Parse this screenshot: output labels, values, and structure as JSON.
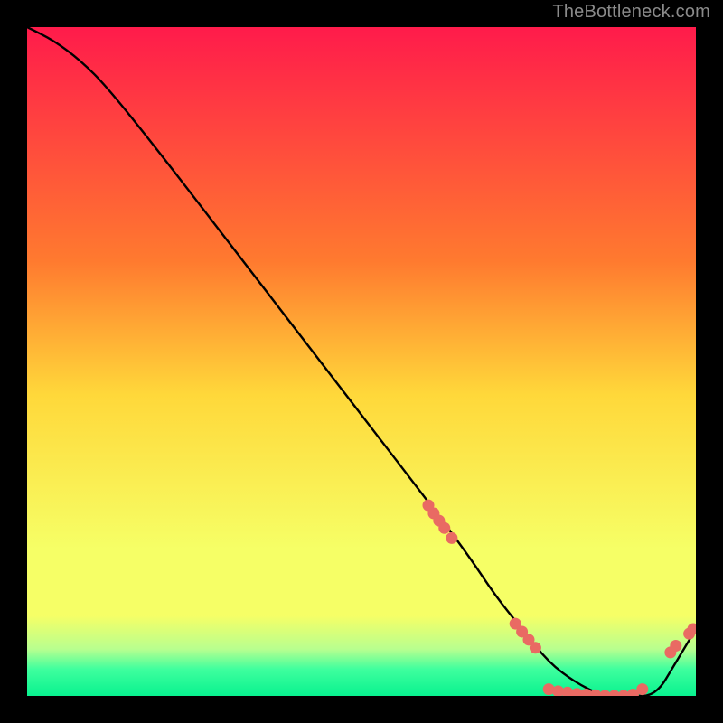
{
  "attribution": "TheBottleneck.com",
  "colors": {
    "gradient_top": "#ff1b4b",
    "gradient_upper_mid": "#ff7a2f",
    "gradient_mid": "#ffd83a",
    "gradient_lower_mid": "#f6ff66",
    "gradient_green_band_top": "#b8ff8f",
    "gradient_green_band_mid": "#3fff9e",
    "gradient_bottom": "#08f28f",
    "line": "#000000",
    "marker": "#e96a63",
    "background": "#000000"
  },
  "chart_data": {
    "type": "line",
    "title": "",
    "xlabel": "",
    "ylabel": "",
    "xlim": [
      0,
      100
    ],
    "ylim": [
      0,
      100
    ],
    "series": [
      {
        "name": "curve",
        "x": [
          0,
          4,
          8,
          12,
          20,
          30,
          40,
          50,
          60,
          66,
          70,
          74,
          78,
          82,
          86,
          90,
          94,
          97,
          100
        ],
        "y": [
          100,
          98,
          95,
          91,
          81,
          68,
          55,
          42,
          29,
          21,
          15,
          10,
          5,
          2,
          0,
          0,
          0,
          5,
          10
        ]
      }
    ],
    "markers": [
      {
        "x": 60.0,
        "y": 28.5
      },
      {
        "x": 60.8,
        "y": 27.3
      },
      {
        "x": 61.6,
        "y": 26.2
      },
      {
        "x": 62.4,
        "y": 25.1
      },
      {
        "x": 63.5,
        "y": 23.6
      },
      {
        "x": 73.0,
        "y": 10.8
      },
      {
        "x": 74.0,
        "y": 9.6
      },
      {
        "x": 75.0,
        "y": 8.4
      },
      {
        "x": 76.0,
        "y": 7.2
      },
      {
        "x": 78.0,
        "y": 1.0
      },
      {
        "x": 79.4,
        "y": 0.7
      },
      {
        "x": 80.8,
        "y": 0.5
      },
      {
        "x": 82.2,
        "y": 0.3
      },
      {
        "x": 83.6,
        "y": 0.2
      },
      {
        "x": 85.0,
        "y": 0.1
      },
      {
        "x": 86.4,
        "y": 0.0
      },
      {
        "x": 87.8,
        "y": 0.0
      },
      {
        "x": 89.2,
        "y": 0.0
      },
      {
        "x": 90.6,
        "y": 0.2
      },
      {
        "x": 92.0,
        "y": 1.0
      },
      {
        "x": 96.2,
        "y": 6.5
      },
      {
        "x": 97.0,
        "y": 7.5
      },
      {
        "x": 99.0,
        "y": 9.3
      },
      {
        "x": 99.6,
        "y": 10.0
      }
    ],
    "gradient_stops_pct": [
      0,
      35,
      55,
      78,
      88,
      93,
      96,
      100
    ]
  }
}
